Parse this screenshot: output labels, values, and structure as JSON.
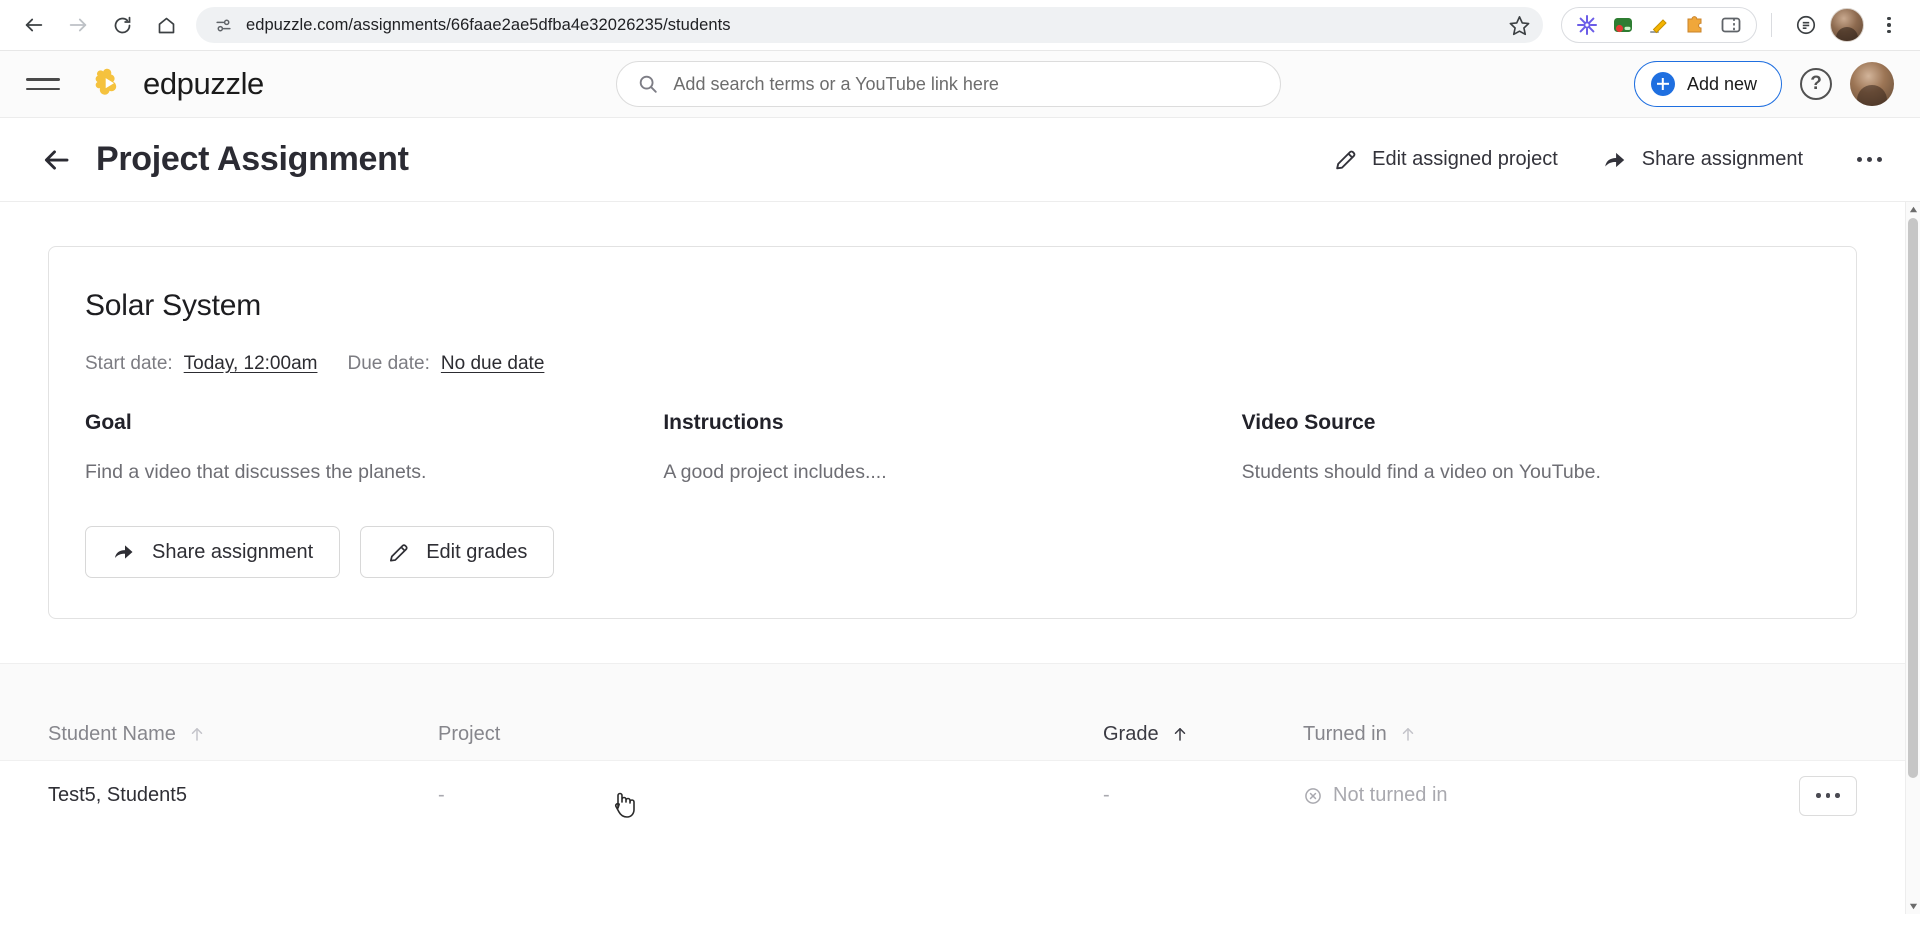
{
  "browser": {
    "back_icon": "back-arrow-icon",
    "forward_icon": "forward-arrow-icon",
    "reload_icon": "reload-icon",
    "home_icon": "home-icon",
    "site_info_icon": "site-settings-icon",
    "url": "edpuzzle.com/assignments/66faae2ae5dfba4e32026235/students",
    "bookmark_icon": "star-icon",
    "extensions": [
      {
        "name": "grammarly-extension-icon",
        "color": "#6b5ce7"
      },
      {
        "name": "screen-recorder-extension-icon",
        "color": "#2e7d32"
      },
      {
        "name": "highlighter-extension-icon",
        "color": "#f4b400"
      },
      {
        "name": "puzzle-extension-icon",
        "color": "#e8a33d"
      },
      {
        "name": "sidebar-extension-icon",
        "color": "#5f6368"
      }
    ],
    "reader_icon": "reader-mode-icon",
    "profile_icon": "chrome-profile-avatar",
    "menu_icon": "chrome-menu-icon"
  },
  "app_header": {
    "menu_icon": "hamburger-menu-icon",
    "brand_name": "edpuzzle",
    "brand_logo": "edpuzzle-puzzle-logo",
    "search": {
      "icon": "search-icon",
      "placeholder": "Add search terms or a YouTube link here",
      "value": ""
    },
    "add_new_label": "Add new",
    "help_label": "?",
    "avatar": "user-avatar"
  },
  "title_bar": {
    "back_icon": "back-arrow-icon",
    "title": "Project Assignment",
    "actions": [
      {
        "label": "Edit assigned project",
        "icon": "pencil-icon"
      },
      {
        "label": "Share assignment",
        "icon": "share-arrow-icon"
      }
    ],
    "overflow_icon": "more-options-icon"
  },
  "assignment_card": {
    "title": "Solar System",
    "start_date_label": "Start date:",
    "start_date_value": "Today, 12:00am",
    "due_date_label": "Due date:",
    "due_date_value": "No due date",
    "columns": [
      {
        "heading": "Goal",
        "body": "Find a video that discusses the planets."
      },
      {
        "heading": "Instructions",
        "body": "A good project includes...."
      },
      {
        "heading": "Video Source",
        "body": "Students should find a video on YouTube."
      }
    ],
    "buttons": [
      {
        "label": "Share assignment",
        "icon": "share-arrow-icon"
      },
      {
        "label": "Edit grades",
        "icon": "pencil-icon"
      }
    ]
  },
  "students_table": {
    "headers": [
      {
        "label": "Student Name",
        "sort_icon": "sort-up-arrow-icon",
        "active": false
      },
      {
        "label": "Project",
        "sort_icon": "",
        "active": false
      },
      {
        "label": "Grade",
        "sort_icon": "sort-up-arrow-icon",
        "active": true
      },
      {
        "label": "Turned in",
        "sort_icon": "sort-up-arrow-icon",
        "active": false
      }
    ],
    "rows": [
      {
        "student_name": "Test5, Student5",
        "project": "-",
        "grade": "-",
        "turned_in_icon": "not-turned-in-icon",
        "turned_in": "Not turned in",
        "menu_icon": "row-more-options-icon"
      }
    ]
  },
  "scrollbar": {
    "up_icon": "scroll-up-arrow-icon",
    "down_icon": "scroll-down-arrow-icon"
  },
  "cursor": {
    "icon": "pointer-hand-cursor"
  }
}
